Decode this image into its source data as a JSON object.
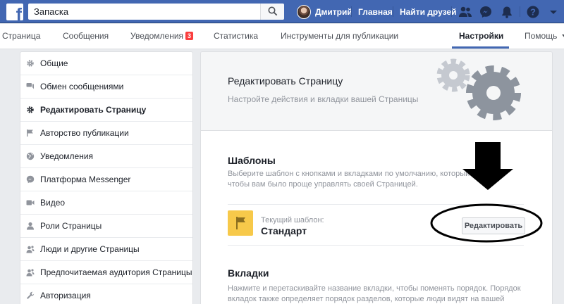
{
  "topbar": {
    "logo": "f",
    "search_value": "Запаска",
    "user_name": "Дмитрий",
    "home_label": "Главная",
    "find_friends_label": "Найти друзей",
    "icons": [
      "friend-requests-icon",
      "messenger-icon",
      "notifications-icon",
      "help-icon",
      "account-menu-icon"
    ]
  },
  "page_tabs": {
    "page": "Страница",
    "messages": "Сообщения",
    "notifications": "Уведомления",
    "notifications_count": "3",
    "stats": "Статистика",
    "publishing_tools": "Инструменты для публикации",
    "settings": "Настройки",
    "help": "Помощь"
  },
  "menu": {
    "items": [
      {
        "label": "Общие",
        "icon": "gear-icon"
      },
      {
        "label": "Обмен сообщениями",
        "icon": "chat-icon"
      },
      {
        "label": "Редактировать Страницу",
        "icon": "gear-icon"
      },
      {
        "label": "Авторство публикации",
        "icon": "flag-icon"
      },
      {
        "label": "Уведомления",
        "icon": "globe-icon"
      },
      {
        "label": "Платформа Messenger",
        "icon": "messenger-icon"
      },
      {
        "label": "Видео",
        "icon": "video-icon"
      },
      {
        "label": "Роли Страницы",
        "icon": "person-icon"
      },
      {
        "label": "Люди и другие Страницы",
        "icon": "people-icon"
      },
      {
        "label": "Предпочитаемая аудитория Страницы",
        "icon": "people-icon"
      },
      {
        "label": "Авторизация",
        "icon": "wrench-icon"
      }
    ],
    "active_index": 2
  },
  "panel": {
    "title": "Редактировать Страницу",
    "subtitle": "Настройте действия и вкладки вашей Страницы",
    "templates": {
      "title": "Шаблоны",
      "desc_line1": "Выберите шаблон с кнопками и вкладками по умолчанию, который был р",
      "desc_line2": "чтобы вам было проще управлять своей Страницей.",
      "current_label": "Текущий шаблон:",
      "current_name": "Стандарт",
      "edit_button": "Редактировать"
    },
    "tabs": {
      "title": "Вкладки",
      "desc_line1": "Нажмите и перетаскивайте название вкладки, чтобы поменять порядок. Порядок",
      "desc_line2": "вкладок также определяет порядок разделов, которые люди видят на вашей"
    }
  },
  "colors": {
    "brand_blue": "#4267b2",
    "badge_red": "#fa3e3e",
    "template_yellow": "#f7c94a"
  }
}
